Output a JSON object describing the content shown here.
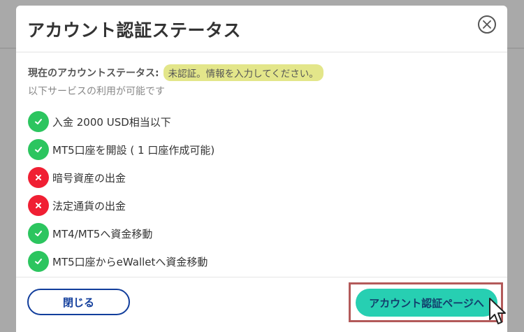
{
  "modal": {
    "title": "アカウント認証ステータス",
    "status_label": "現在のアカウントステータス:",
    "status_badge": "未認証。情報を入力してください。",
    "sub_text": "以下サービスの利用が可能です",
    "permissions": [
      {
        "label": "入金 2000 USD相当以下",
        "allowed": true
      },
      {
        "label": "MT5口座を開設 ( 1 口座作成可能)",
        "allowed": true
      },
      {
        "label": "暗号資産の出金",
        "allowed": false
      },
      {
        "label": "法定通貨の出金",
        "allowed": false
      },
      {
        "label": "MT4/MT5へ資金移動",
        "allowed": true
      },
      {
        "label": "MT5口座からeWalletへ資金移動",
        "allowed": true
      }
    ],
    "close_button": "閉じる",
    "verify_button": "アカウント認証ページへ"
  },
  "colors": {
    "allowed": "#2cc55f",
    "denied": "#f01f33",
    "badge": "#e3e68a",
    "primary_button": "#27cfb2",
    "outline_button": "#123e9c",
    "highlight": "#b35a5a"
  },
  "icons": {
    "close": "close-circle-icon",
    "allowed": "check-icon",
    "denied": "cross-icon",
    "pointer": "mouse-cursor-icon"
  }
}
